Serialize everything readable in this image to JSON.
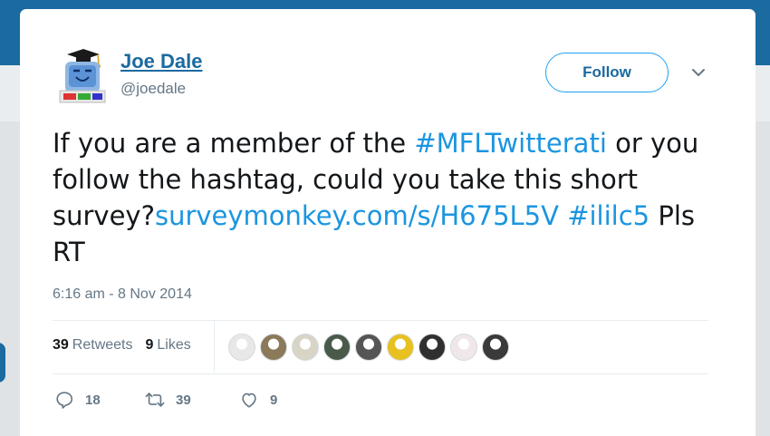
{
  "tweet": {
    "author_name": "Joe Dale",
    "author_handle": "@joedale",
    "follow_label": "Follow",
    "text": {
      "part1": "If you are a member of the ",
      "hashtag1": "#MFLTwitterati",
      "part2": " or you follow the hashtag, could you take this short survey?",
      "link": "surveymonkey.com/s/H675L5V",
      "part3": " ",
      "hashtag2": "#ililc5",
      "part4": " Pls RT"
    },
    "timestamp": "6:16 am - 8 Nov 2014",
    "stats": {
      "retweets_count": "39",
      "retweets_label": "Retweets",
      "likes_count": "9",
      "likes_label": "Likes"
    },
    "likers": [
      {
        "name": "liker-avatar-1",
        "color": "#e8e8e8"
      },
      {
        "name": "liker-avatar-2",
        "color": "#8a7a5a"
      },
      {
        "name": "liker-avatar-3",
        "color": "#d8d4c6"
      },
      {
        "name": "liker-avatar-4",
        "color": "#4a5a4a"
      },
      {
        "name": "liker-avatar-5",
        "color": "#555555"
      },
      {
        "name": "liker-avatar-6",
        "color": "#e8c020"
      },
      {
        "name": "liker-avatar-7",
        "color": "#303030"
      },
      {
        "name": "liker-avatar-8",
        "color": "#f0e8e8"
      },
      {
        "name": "liker-avatar-9",
        "color": "#3a3a3a"
      }
    ],
    "actions": {
      "reply_count": "18",
      "retweet_count": "39",
      "like_count": "9"
    }
  },
  "colors": {
    "link": "#1b95e0",
    "name": "#1b6aa0",
    "muted": "#657786",
    "top_bar": "#1b6aa0"
  }
}
